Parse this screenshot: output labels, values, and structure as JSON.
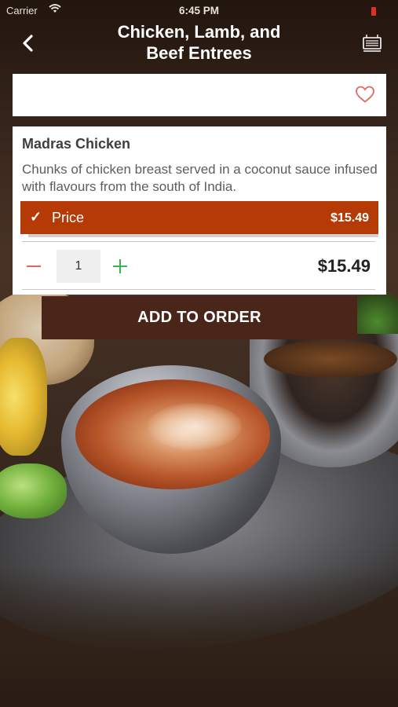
{
  "status_bar": {
    "carrier": "Carrier",
    "time": "6:45 PM",
    "wifi_icon": "wifi-icon",
    "battery_icon": "battery-icon",
    "battery_color": "#e0301f"
  },
  "nav": {
    "back_icon": "chevron-left-icon",
    "title_line1": "Chicken, Lamb, and",
    "title_line2": "Beef Entrees",
    "menu_icon": "restaurant-menu-icon"
  },
  "favorite": {
    "icon": "heart-outline-icon",
    "color": "#e06a62"
  },
  "item": {
    "name": "Madras Chicken",
    "description": "Chunks of chicken breast served in a coconut sauce infused with flavours from the south of India.",
    "price_option": {
      "selected": true,
      "check_icon": "checkmark-icon",
      "label": "Price",
      "amount": "$15.49"
    },
    "quantity": "1",
    "decrease_icon": "minus-icon",
    "increase_icon": "plus-icon",
    "total": "$15.49"
  },
  "add_button": {
    "label": "ADD TO ORDER"
  },
  "colors": {
    "accent_price_bar": "#b53a06",
    "add_button_bg": "#4a2519",
    "minus_color": "#e2675b",
    "plus_color": "#3eb04b"
  }
}
